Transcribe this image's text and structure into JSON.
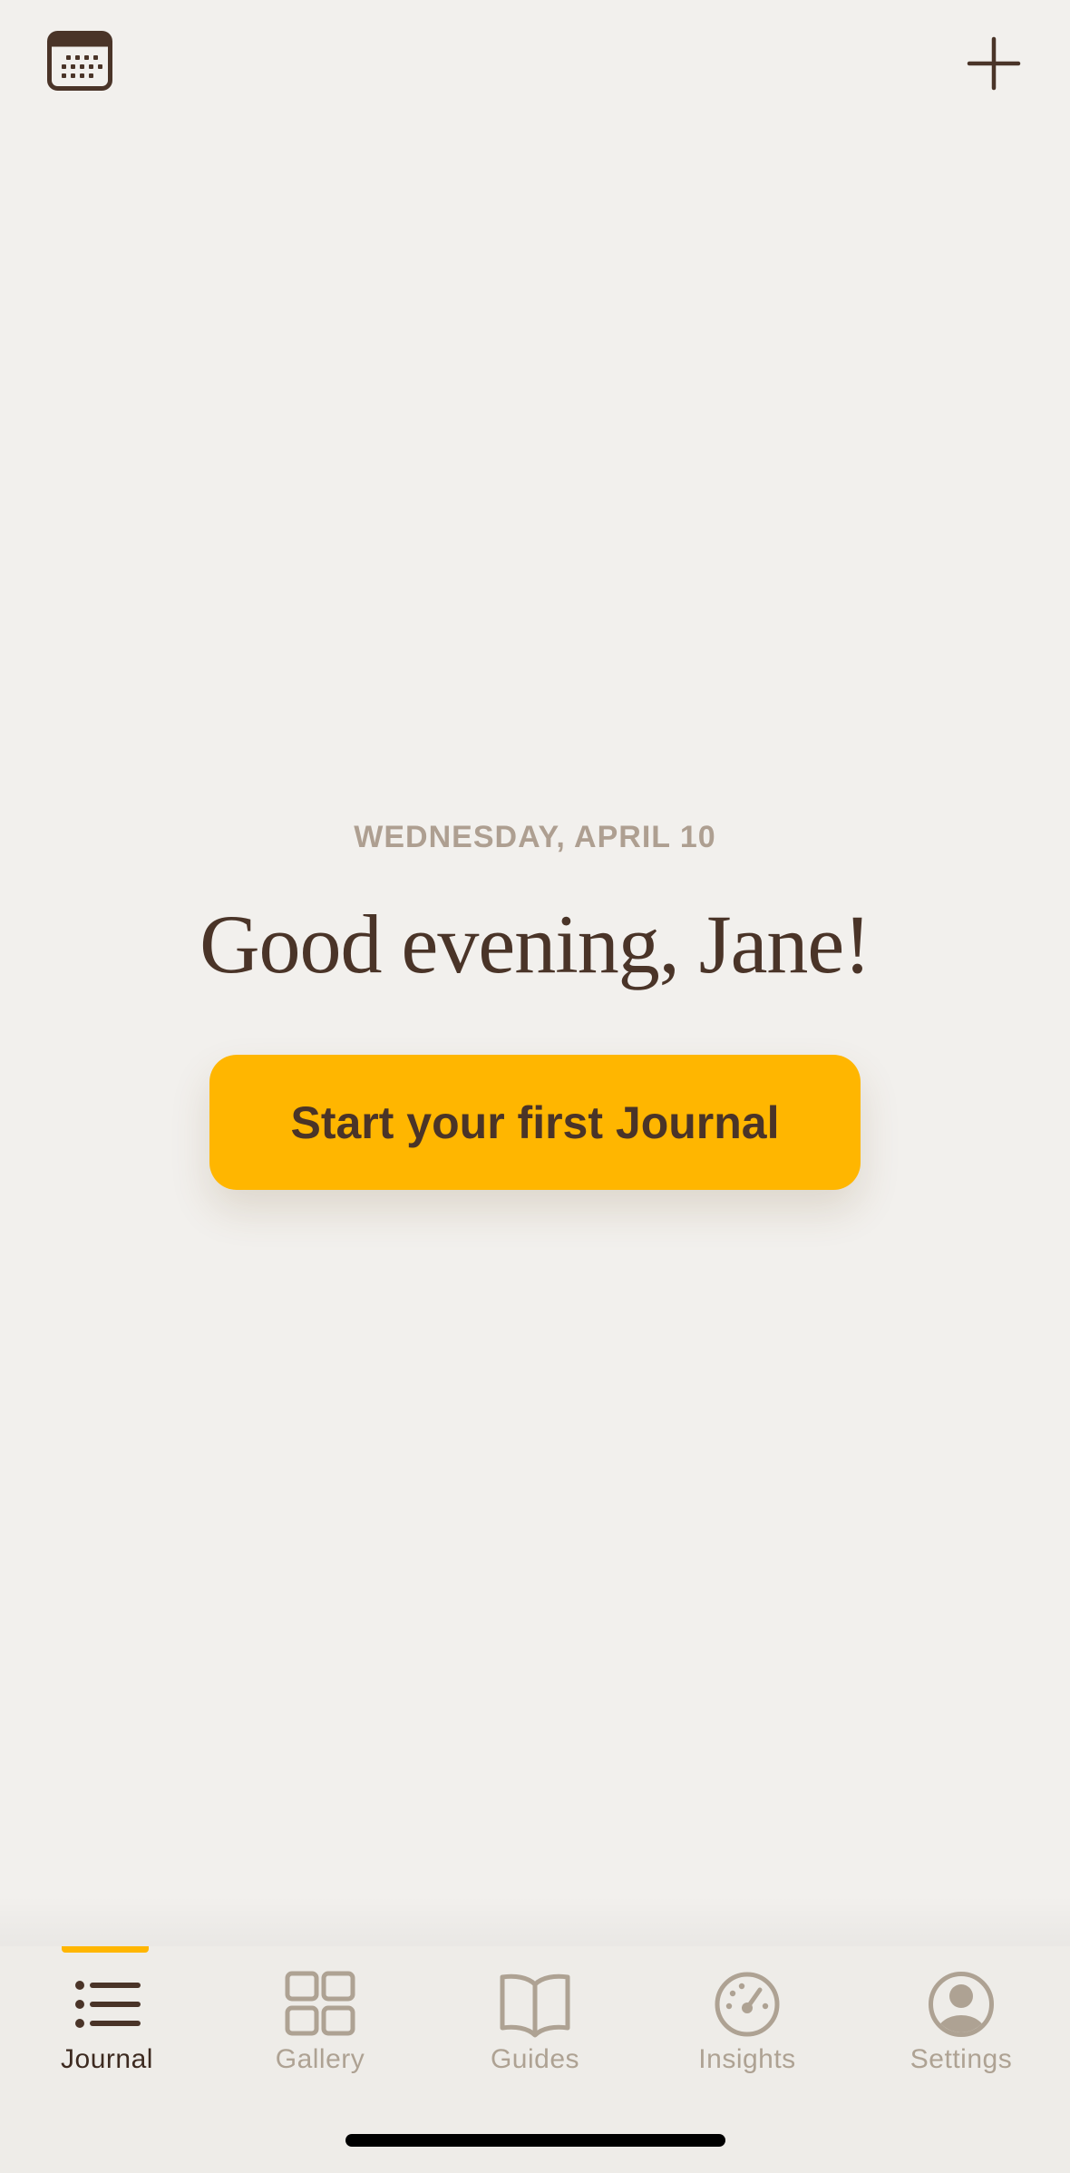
{
  "header": {
    "calendar_icon": "calendar-icon",
    "add_icon": "plus-icon"
  },
  "main": {
    "date": "WEDNESDAY, APRIL 10",
    "greeting": "Good evening, Jane!",
    "cta_label": "Start your first Journal"
  },
  "tabs": [
    {
      "label": "Journal",
      "icon": "list-icon",
      "active": true
    },
    {
      "label": "Gallery",
      "icon": "grid-icon",
      "active": false
    },
    {
      "label": "Guides",
      "icon": "book-icon",
      "active": false
    },
    {
      "label": "Insights",
      "icon": "gauge-icon",
      "active": false
    },
    {
      "label": "Settings",
      "icon": "profile-icon",
      "active": false
    }
  ],
  "colors": {
    "background": "#f2f0ed",
    "accent": "#ffb600",
    "text_dark": "#4a3428",
    "text_muted": "#ae9f91",
    "tab_inactive": "#aea293"
  }
}
